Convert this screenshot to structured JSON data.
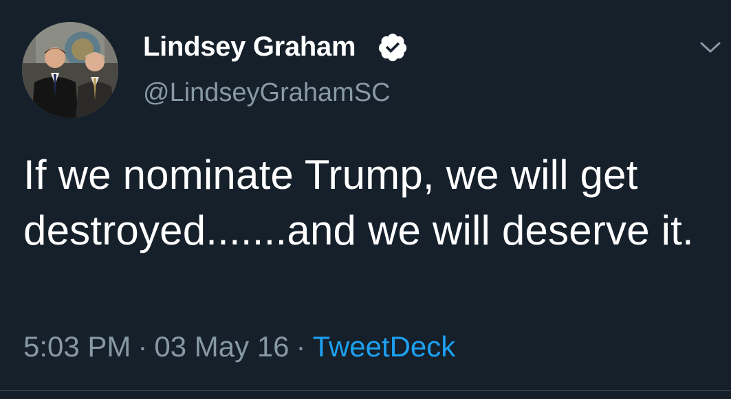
{
  "tweet": {
    "display_name": "Lindsey Graham",
    "verified": true,
    "handle": "@LindseyGrahamSC",
    "text": "If we nominate Trump, we will get destroyed.......and we will deserve it.",
    "time": "5:03 PM",
    "separator": "·",
    "date": "03 May 16",
    "source": "TweetDeck"
  },
  "icons": {
    "avatar": "profile-photo",
    "verified": "verified-badge-icon",
    "menu": "chevron-down-icon"
  },
  "colors": {
    "background": "#15202b",
    "text": "#ffffff",
    "secondary_text": "#8899a6",
    "link": "#1da1f2",
    "divider": "#38444d"
  }
}
